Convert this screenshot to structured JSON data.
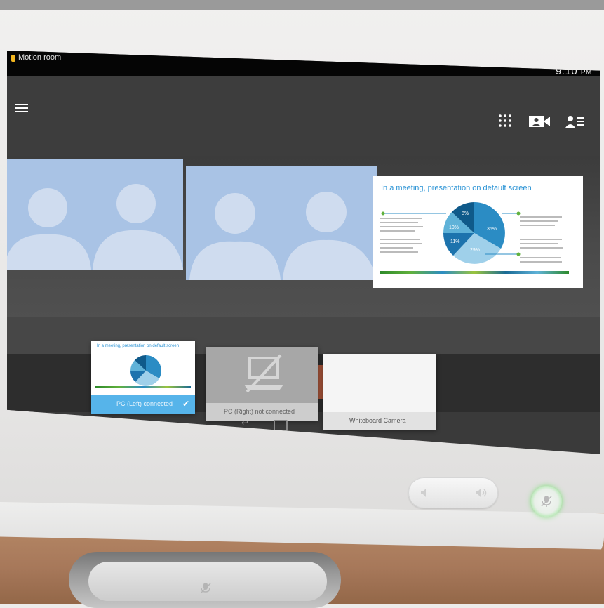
{
  "status_bar": {
    "room_name": "Motion room",
    "time": "9:10",
    "time_suffix": "PM"
  },
  "app_bar": {
    "icons": [
      "menu-icon",
      "keypad-icon",
      "camera-icon",
      "contacts-icon"
    ]
  },
  "presentation": {
    "title": "In a meeting, presentation on default screen",
    "pie_labels": [
      "8%",
      "10%",
      "11%",
      "29%",
      "36%"
    ],
    "pie_colors": [
      "#0f5a8a",
      "#1d73ad",
      "#2b8cc4",
      "#5fb2d8",
      "#9fd0ea"
    ]
  },
  "sources": [
    {
      "label": "PC (Left) connected",
      "selected": true
    },
    {
      "label": "PC (Right) not connected",
      "selected": false
    },
    {
      "label": "Whiteboard Camera",
      "selected": false
    }
  ],
  "hardware": {
    "icons": [
      "volume-down-icon",
      "volume-up-icon",
      "mic-mute-icon"
    ],
    "mute_glow_color": "#7fe07a"
  }
}
